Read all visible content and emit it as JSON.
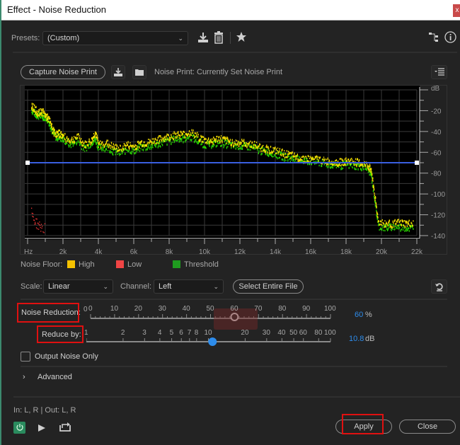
{
  "window": {
    "title": "Effect - Noise Reduction",
    "close_label": "x"
  },
  "presets": {
    "label": "Presets:",
    "value": "(Custom)"
  },
  "toolbar_icons": [
    "save-preset-icon",
    "delete-preset-icon",
    "favorite-star-icon",
    "routing-icon",
    "info-icon"
  ],
  "noise_print": {
    "capture_label": "Capture Noise Print",
    "label": "Noise Print:",
    "value": "Currently Set Noise Print"
  },
  "chart_data": {
    "type": "scatter",
    "title": "Noise Floor",
    "xlabel": "Hz",
    "ylabel": "dB",
    "x_ticks": [
      "Hz",
      "2k",
      "4k",
      "6k",
      "8k",
      "10k",
      "12k",
      "14k",
      "16k",
      "18k",
      "20k",
      "22k"
    ],
    "y_ticks": [
      "dB",
      "-20",
      "-40",
      "-60",
      "-80",
      "-100",
      "-120",
      "-140"
    ],
    "xlim": [
      0,
      22000
    ],
    "ylim": [
      -140,
      0
    ],
    "grid": true,
    "threshold_db": -70,
    "series": [
      {
        "name": "High",
        "color": "#f5e000",
        "points": [
          [
            200,
            -14
          ],
          [
            400,
            -18
          ],
          [
            600,
            -22
          ],
          [
            800,
            -20
          ],
          [
            1000,
            -24
          ],
          [
            1200,
            -28
          ],
          [
            1400,
            -38
          ],
          [
            1600,
            -42
          ],
          [
            1800,
            -41
          ],
          [
            2000,
            -44
          ],
          [
            2400,
            -48
          ],
          [
            2800,
            -44
          ],
          [
            3200,
            -52
          ],
          [
            3600,
            -48
          ],
          [
            3800,
            -40
          ],
          [
            4000,
            -52
          ],
          [
            4400,
            -50
          ],
          [
            4800,
            -54
          ],
          [
            5200,
            -56
          ],
          [
            5600,
            -52
          ],
          [
            6000,
            -54
          ],
          [
            6400,
            -50
          ],
          [
            6800,
            -50
          ],
          [
            7200,
            -48
          ],
          [
            7600,
            -46
          ],
          [
            8000,
            -44
          ],
          [
            8400,
            -42
          ],
          [
            8800,
            -42
          ],
          [
            9200,
            -40
          ],
          [
            9600,
            -44
          ],
          [
            10000,
            -48
          ],
          [
            10400,
            -48
          ],
          [
            10800,
            -46
          ],
          [
            11200,
            -48
          ],
          [
            11600,
            -50
          ],
          [
            12000,
            -50
          ],
          [
            12400,
            -51
          ],
          [
            12800,
            -52
          ],
          [
            13200,
            -55
          ],
          [
            13600,
            -56
          ],
          [
            14000,
            -58
          ],
          [
            14400,
            -60
          ],
          [
            14800,
            -62
          ],
          [
            15200,
            -64
          ],
          [
            15600,
            -65
          ],
          [
            16000,
            -66
          ],
          [
            16400,
            -66
          ],
          [
            16800,
            -68
          ],
          [
            17200,
            -68
          ],
          [
            17600,
            -69
          ],
          [
            18000,
            -68
          ],
          [
            18400,
            -68
          ],
          [
            18800,
            -70
          ],
          [
            19200,
            -72
          ],
          [
            19400,
            -76
          ],
          [
            19600,
            -100
          ],
          [
            19800,
            -126
          ],
          [
            20200,
            -128
          ],
          [
            20600,
            -128
          ],
          [
            21000,
            -127
          ],
          [
            21400,
            -128
          ],
          [
            21800,
            -128
          ]
        ]
      },
      {
        "name": "Low",
        "color": "#ff3a3a",
        "points": [
          [
            200,
            -118
          ],
          [
            300,
            -122
          ],
          [
            400,
            -126
          ],
          [
            500,
            -128
          ],
          [
            600,
            -130
          ],
          [
            700,
            -131
          ],
          [
            800,
            -132
          ],
          [
            1000,
            -133
          ]
        ]
      },
      {
        "name": "Threshold",
        "color": "#28d400",
        "points": [
          [
            200,
            -18
          ],
          [
            400,
            -22
          ],
          [
            600,
            -24
          ],
          [
            800,
            -24
          ],
          [
            1000,
            -26
          ],
          [
            1200,
            -30
          ],
          [
            1400,
            -40
          ],
          [
            1600,
            -45
          ],
          [
            1800,
            -44
          ],
          [
            2000,
            -47
          ],
          [
            2400,
            -52
          ],
          [
            2800,
            -48
          ],
          [
            3200,
            -56
          ],
          [
            3600,
            -50
          ],
          [
            3800,
            -46
          ],
          [
            4000,
            -55
          ],
          [
            4400,
            -54
          ],
          [
            4800,
            -58
          ],
          [
            5200,
            -60
          ],
          [
            5600,
            -56
          ],
          [
            6000,
            -58
          ],
          [
            6400,
            -54
          ],
          [
            6800,
            -54
          ],
          [
            7200,
            -52
          ],
          [
            7600,
            -50
          ],
          [
            8000,
            -48
          ],
          [
            8400,
            -46
          ],
          [
            8800,
            -46
          ],
          [
            9200,
            -44
          ],
          [
            9600,
            -48
          ],
          [
            10000,
            -52
          ],
          [
            10400,
            -51
          ],
          [
            10800,
            -50
          ],
          [
            11200,
            -51
          ],
          [
            11600,
            -53
          ],
          [
            12000,
            -53
          ],
          [
            12400,
            -54
          ],
          [
            12800,
            -55
          ],
          [
            13200,
            -58
          ],
          [
            13600,
            -59
          ],
          [
            14000,
            -61
          ],
          [
            14400,
            -63
          ],
          [
            14800,
            -65
          ],
          [
            15200,
            -66
          ],
          [
            15600,
            -67
          ],
          [
            16000,
            -68
          ],
          [
            16400,
            -69
          ],
          [
            16800,
            -70
          ],
          [
            17200,
            -71
          ],
          [
            17600,
            -72
          ],
          [
            18000,
            -71
          ],
          [
            18400,
            -72
          ],
          [
            18800,
            -73
          ],
          [
            19200,
            -75
          ],
          [
            19400,
            -80
          ],
          [
            19600,
            -104
          ],
          [
            19800,
            -130
          ],
          [
            20200,
            -132
          ],
          [
            20600,
            -131
          ],
          [
            21000,
            -131
          ],
          [
            21400,
            -132
          ],
          [
            21800,
            -132
          ]
        ]
      }
    ]
  },
  "legend": {
    "label": "Noise Floor:",
    "items": [
      {
        "name": "High",
        "color": "#f5c200"
      },
      {
        "name": "Low",
        "color": "#f04545"
      },
      {
        "name": "Threshold",
        "color": "#1f9b1f"
      }
    ]
  },
  "controls": {
    "scale_label": "Scale:",
    "scale_value": "Linear",
    "channel_label": "Channel:",
    "channel_value": "Left",
    "select_entire_file": "Select Entire File"
  },
  "noise_reduction": {
    "label": "Noise Reduction:",
    "ticks": [
      "0",
      "10",
      "20",
      "30",
      "40",
      "50",
      "60",
      "70",
      "80",
      "90",
      "100"
    ],
    "extra_tick": "0",
    "value": 60,
    "value_text": "60",
    "unit": "%"
  },
  "reduce_by": {
    "label": "Reduce by:",
    "ticks": [
      "1",
      "2",
      "3",
      "4",
      "5",
      "6",
      "7",
      "8",
      "10",
      "20",
      "30",
      "40",
      "50",
      "60",
      "80",
      "100"
    ],
    "value": 10.8,
    "value_text": "10.8",
    "unit": "dB"
  },
  "output_noise_only": {
    "label": "Output Noise Only",
    "checked": false
  },
  "advanced": {
    "label": "Advanced"
  },
  "io": {
    "text": "In: L, R | Out: L, R"
  },
  "buttons": {
    "apply": "Apply",
    "close": "Close"
  }
}
